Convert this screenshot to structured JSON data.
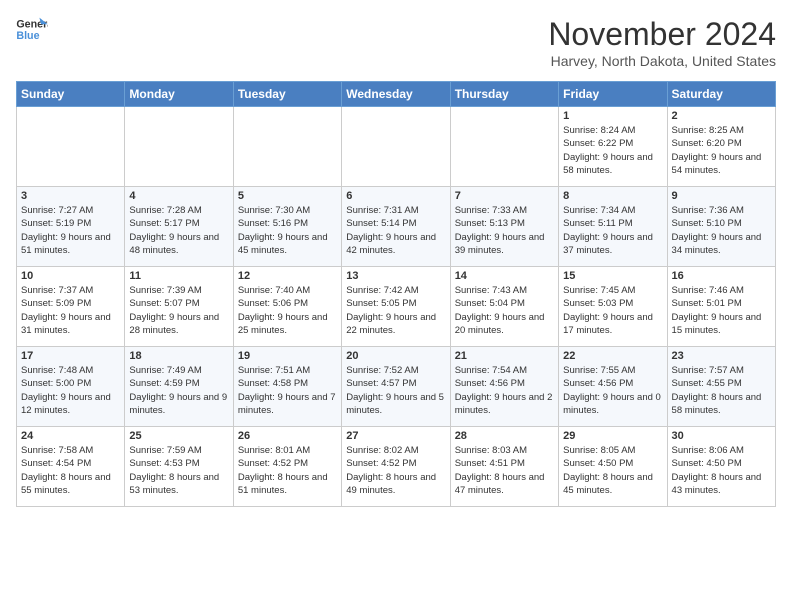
{
  "header": {
    "logo_line1": "General",
    "logo_line2": "Blue",
    "month": "November 2024",
    "location": "Harvey, North Dakota, United States"
  },
  "weekdays": [
    "Sunday",
    "Monday",
    "Tuesday",
    "Wednesday",
    "Thursday",
    "Friday",
    "Saturday"
  ],
  "weeks": [
    [
      {
        "day": "",
        "content": ""
      },
      {
        "day": "",
        "content": ""
      },
      {
        "day": "",
        "content": ""
      },
      {
        "day": "",
        "content": ""
      },
      {
        "day": "",
        "content": ""
      },
      {
        "day": "1",
        "content": "Sunrise: 8:24 AM\nSunset: 6:22 PM\nDaylight: 9 hours and 58 minutes."
      },
      {
        "day": "2",
        "content": "Sunrise: 8:25 AM\nSunset: 6:20 PM\nDaylight: 9 hours and 54 minutes."
      }
    ],
    [
      {
        "day": "3",
        "content": "Sunrise: 7:27 AM\nSunset: 5:19 PM\nDaylight: 9 hours and 51 minutes."
      },
      {
        "day": "4",
        "content": "Sunrise: 7:28 AM\nSunset: 5:17 PM\nDaylight: 9 hours and 48 minutes."
      },
      {
        "day": "5",
        "content": "Sunrise: 7:30 AM\nSunset: 5:16 PM\nDaylight: 9 hours and 45 minutes."
      },
      {
        "day": "6",
        "content": "Sunrise: 7:31 AM\nSunset: 5:14 PM\nDaylight: 9 hours and 42 minutes."
      },
      {
        "day": "7",
        "content": "Sunrise: 7:33 AM\nSunset: 5:13 PM\nDaylight: 9 hours and 39 minutes."
      },
      {
        "day": "8",
        "content": "Sunrise: 7:34 AM\nSunset: 5:11 PM\nDaylight: 9 hours and 37 minutes."
      },
      {
        "day": "9",
        "content": "Sunrise: 7:36 AM\nSunset: 5:10 PM\nDaylight: 9 hours and 34 minutes."
      }
    ],
    [
      {
        "day": "10",
        "content": "Sunrise: 7:37 AM\nSunset: 5:09 PM\nDaylight: 9 hours and 31 minutes."
      },
      {
        "day": "11",
        "content": "Sunrise: 7:39 AM\nSunset: 5:07 PM\nDaylight: 9 hours and 28 minutes."
      },
      {
        "day": "12",
        "content": "Sunrise: 7:40 AM\nSunset: 5:06 PM\nDaylight: 9 hours and 25 minutes."
      },
      {
        "day": "13",
        "content": "Sunrise: 7:42 AM\nSunset: 5:05 PM\nDaylight: 9 hours and 22 minutes."
      },
      {
        "day": "14",
        "content": "Sunrise: 7:43 AM\nSunset: 5:04 PM\nDaylight: 9 hours and 20 minutes."
      },
      {
        "day": "15",
        "content": "Sunrise: 7:45 AM\nSunset: 5:03 PM\nDaylight: 9 hours and 17 minutes."
      },
      {
        "day": "16",
        "content": "Sunrise: 7:46 AM\nSunset: 5:01 PM\nDaylight: 9 hours and 15 minutes."
      }
    ],
    [
      {
        "day": "17",
        "content": "Sunrise: 7:48 AM\nSunset: 5:00 PM\nDaylight: 9 hours and 12 minutes."
      },
      {
        "day": "18",
        "content": "Sunrise: 7:49 AM\nSunset: 4:59 PM\nDaylight: 9 hours and 9 minutes."
      },
      {
        "day": "19",
        "content": "Sunrise: 7:51 AM\nSunset: 4:58 PM\nDaylight: 9 hours and 7 minutes."
      },
      {
        "day": "20",
        "content": "Sunrise: 7:52 AM\nSunset: 4:57 PM\nDaylight: 9 hours and 5 minutes."
      },
      {
        "day": "21",
        "content": "Sunrise: 7:54 AM\nSunset: 4:56 PM\nDaylight: 9 hours and 2 minutes."
      },
      {
        "day": "22",
        "content": "Sunrise: 7:55 AM\nSunset: 4:56 PM\nDaylight: 9 hours and 0 minutes."
      },
      {
        "day": "23",
        "content": "Sunrise: 7:57 AM\nSunset: 4:55 PM\nDaylight: 8 hours and 58 minutes."
      }
    ],
    [
      {
        "day": "24",
        "content": "Sunrise: 7:58 AM\nSunset: 4:54 PM\nDaylight: 8 hours and 55 minutes."
      },
      {
        "day": "25",
        "content": "Sunrise: 7:59 AM\nSunset: 4:53 PM\nDaylight: 8 hours and 53 minutes."
      },
      {
        "day": "26",
        "content": "Sunrise: 8:01 AM\nSunset: 4:52 PM\nDaylight: 8 hours and 51 minutes."
      },
      {
        "day": "27",
        "content": "Sunrise: 8:02 AM\nSunset: 4:52 PM\nDaylight: 8 hours and 49 minutes."
      },
      {
        "day": "28",
        "content": "Sunrise: 8:03 AM\nSunset: 4:51 PM\nDaylight: 8 hours and 47 minutes."
      },
      {
        "day": "29",
        "content": "Sunrise: 8:05 AM\nSunset: 4:50 PM\nDaylight: 8 hours and 45 minutes."
      },
      {
        "day": "30",
        "content": "Sunrise: 8:06 AM\nSunset: 4:50 PM\nDaylight: 8 hours and 43 minutes."
      }
    ]
  ]
}
